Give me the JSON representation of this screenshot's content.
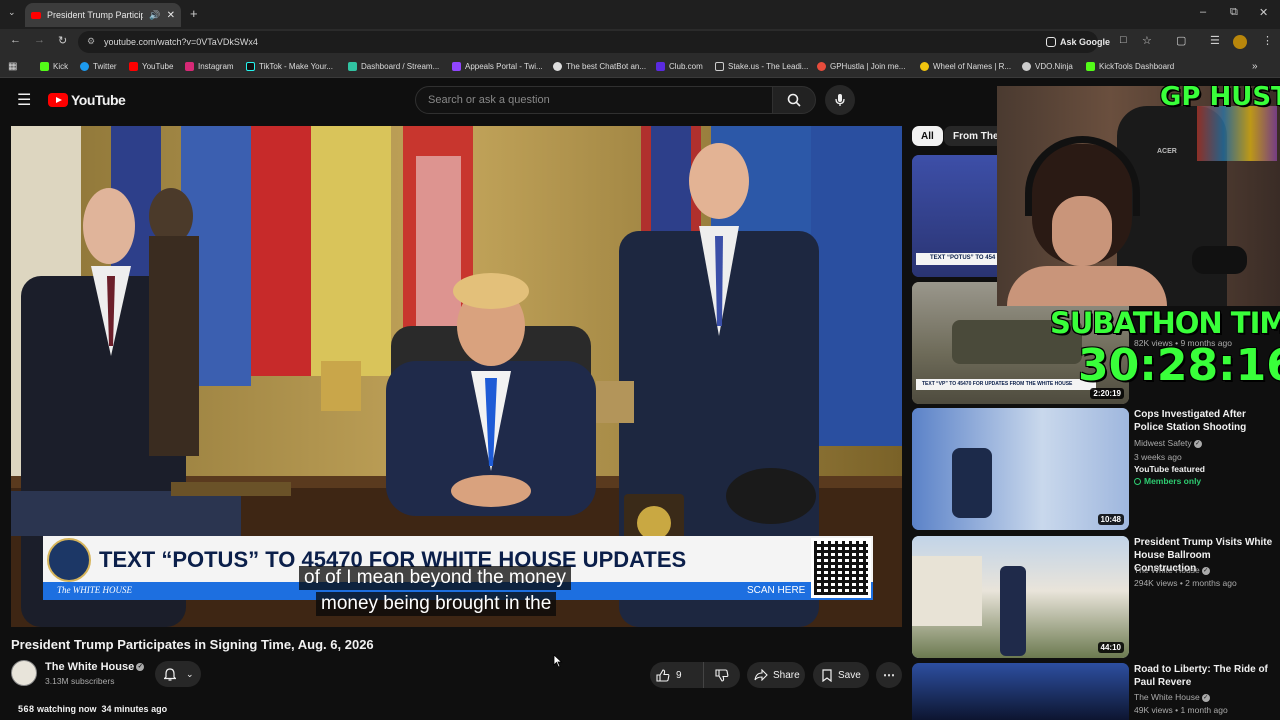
{
  "browser": {
    "tab_title": "President Trump Participates",
    "url": "youtube.com/watch?v=0VTaVDkSWx4",
    "ask_google": "Ask Google",
    "bookmarks": [
      "Kick",
      "Twitter",
      "YouTube",
      "Instagram",
      "TikTok - Make Your...",
      "Dashboard / Stream...",
      "Appeals Portal - Twi...",
      "The best ChatBot an...",
      "Club.com",
      "Stake.us - The Leadi...",
      "GPHustla | Join me...",
      "Wheel of Names | R...",
      "VDO.Ninja",
      "KickTools Dashboard"
    ]
  },
  "youtube": {
    "logo_text": "YouTube",
    "search_placeholder": "Search or ask a question"
  },
  "player": {
    "banner_text": "TEXT “POTUS” TO 45470 FOR WHITE HOUSE UPDATES",
    "banner_brand": "The WHITE HOUSE",
    "scan_here": "SCAN HERE",
    "caption_line1": "of of I mean beyond the money",
    "caption_line2": "money being brought in the"
  },
  "video": {
    "title": "President Trump Participates in Signing Time, Aug. 6, 2026",
    "channel": "The White House",
    "subscribers": "3.13M subscribers",
    "like_count": "9",
    "share_label": "Share",
    "save_label": "Save",
    "watching": "watching now",
    "watching_count": "5 6 8",
    "age": "34 minutes ago"
  },
  "sidebar": {
    "chips": [
      "All",
      "From The W"
    ],
    "items": [
      {
        "title": "",
        "channel": "",
        "meta": "",
        "duration": "",
        "thumb_text": "TEXT “POTUS” TO 454"
      },
      {
        "title": "",
        "channel": "",
        "meta": "82K views • 9 months ago",
        "duration": "2:20:19",
        "thumb_text": "TEXT “VP” TO 45470 FOR UPDATES FROM THE WHITE HOUSE"
      },
      {
        "title": "Cops Investigated After Police Station Shooting",
        "channel": "Midwest Safety",
        "meta": "3 weeks ago",
        "featured": "YouTube featured",
        "badge": "Members only",
        "duration": "10:48"
      },
      {
        "title": "President Trump Visits White House Ballroom Construction",
        "channel": "The White House",
        "meta": "294K views • 2 months ago",
        "duration": "44:10"
      },
      {
        "title": "Road to Liberty: The Ride of Paul Revere",
        "channel": "The White House",
        "meta": "49K views • 1 month ago",
        "duration": ""
      }
    ]
  },
  "overlay": {
    "streamer_name": "GP HUSTLA",
    "timer_label": "SUBATHON TIMER",
    "timer_value": "30:28:16",
    "cam_brand": "ACER"
  },
  "colors": {
    "yt_red": "#ff0000",
    "timer_green": "#39ff3a",
    "bg": "#0f0f0f"
  }
}
